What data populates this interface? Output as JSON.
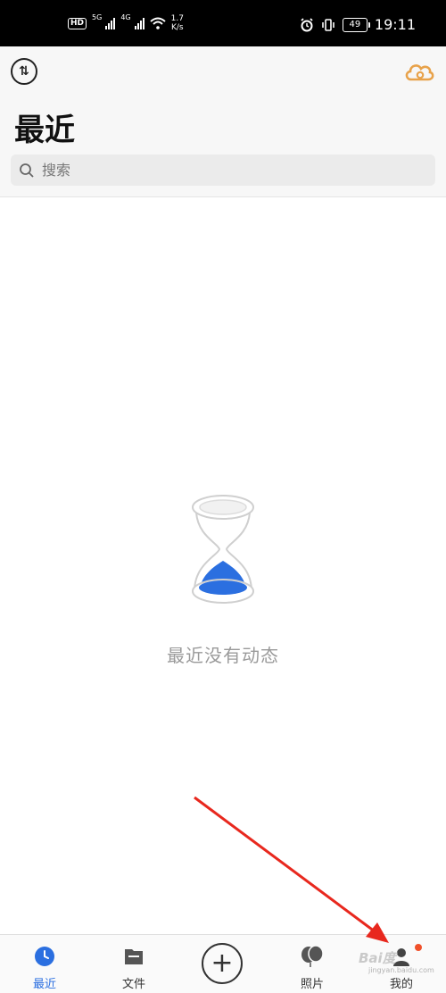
{
  "status_bar": {
    "hd": "HD",
    "sim1_network": "5G",
    "sim2_network": "4G",
    "speed_value": "1.7",
    "speed_unit": "K/s",
    "battery": "49",
    "time": "19:11"
  },
  "header": {
    "title": "最近",
    "sort_icon": "sort-arrows-icon",
    "cloud_icon": "cloud-icon",
    "accent_cloud_color": "#e8a24a"
  },
  "search": {
    "placeholder": "搜索",
    "value": ""
  },
  "empty_state": {
    "message": "最近没有动态",
    "illustration": "hourglass-icon",
    "sand_color": "#2b6fe0"
  },
  "bottom_nav": {
    "items": [
      {
        "label": "最近",
        "icon": "clock-icon",
        "active": true
      },
      {
        "label": "文件",
        "icon": "folder-icon",
        "active": false
      },
      {
        "label": "",
        "icon": "plus-icon",
        "active": false
      },
      {
        "label": "照片",
        "icon": "photo-balloon-icon",
        "active": false
      },
      {
        "label": "我的",
        "icon": "person-icon",
        "active": false
      }
    ],
    "active_color": "#2b6fe0",
    "badge_color": "#f0502a"
  },
  "overlay": {
    "arrow_color": "#e8281e",
    "watermark": "Bai度",
    "watermark_sub": "jingyan.baidu.com"
  }
}
